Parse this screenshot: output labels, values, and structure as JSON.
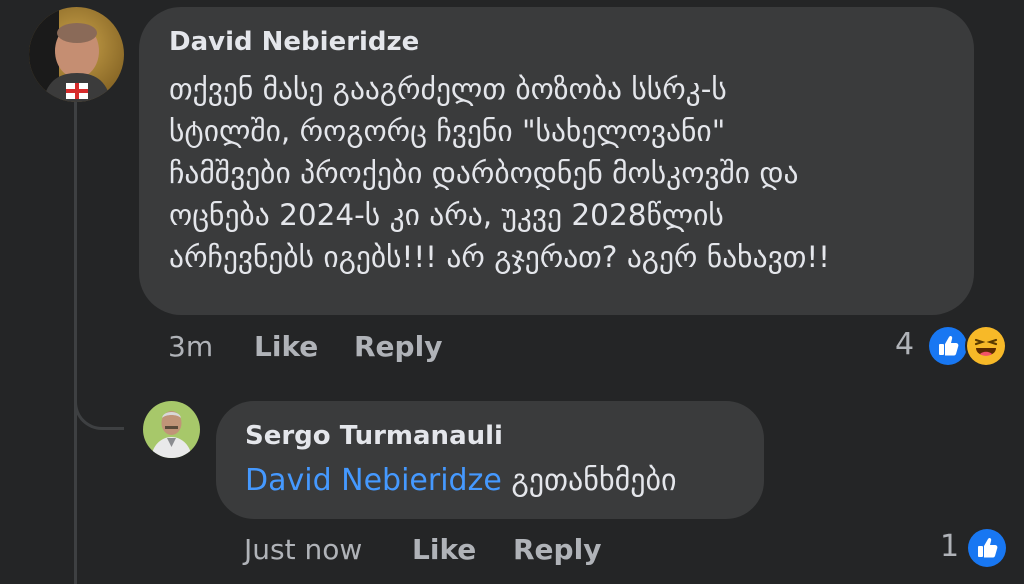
{
  "main_comment": {
    "author": "David Nebieridze",
    "text_lines": [
      "თქვენ მასე გააგრძელთ ბოზობა სსრკ-ს",
      "სტილში, როგორც ჩვენი \"სახელოვანი\"",
      "ჩამშვები პროქები დარბოდნენ მოსკოვში და",
      "ოცნება 2024-ს კი არა, უკვე 2028წლის",
      "არჩევნებს იგებს!!! არ გჯერათ? აგერ ნახავთ!!"
    ],
    "time": "3m",
    "like_label": "Like",
    "reply_label": "Reply",
    "reaction_count": "4",
    "reactions": [
      "like-icon",
      "haha-icon"
    ]
  },
  "reply_comment": {
    "author": "Sergo Turmanauli",
    "mention": "David Nebieridze",
    "text": " გეთანხმები",
    "time": "Just now",
    "like_label": "Like",
    "reply_label": "Reply",
    "reaction_count": "1",
    "reactions": [
      "like-icon"
    ]
  },
  "colors": {
    "background": "#242526",
    "bubble": "#3a3b3c",
    "text": "#e4e6eb",
    "secondary_text": "#b0b3b8",
    "mention": "#4599ff",
    "like_blue": "#1877f2",
    "haha_yellow": "#f7b928"
  }
}
